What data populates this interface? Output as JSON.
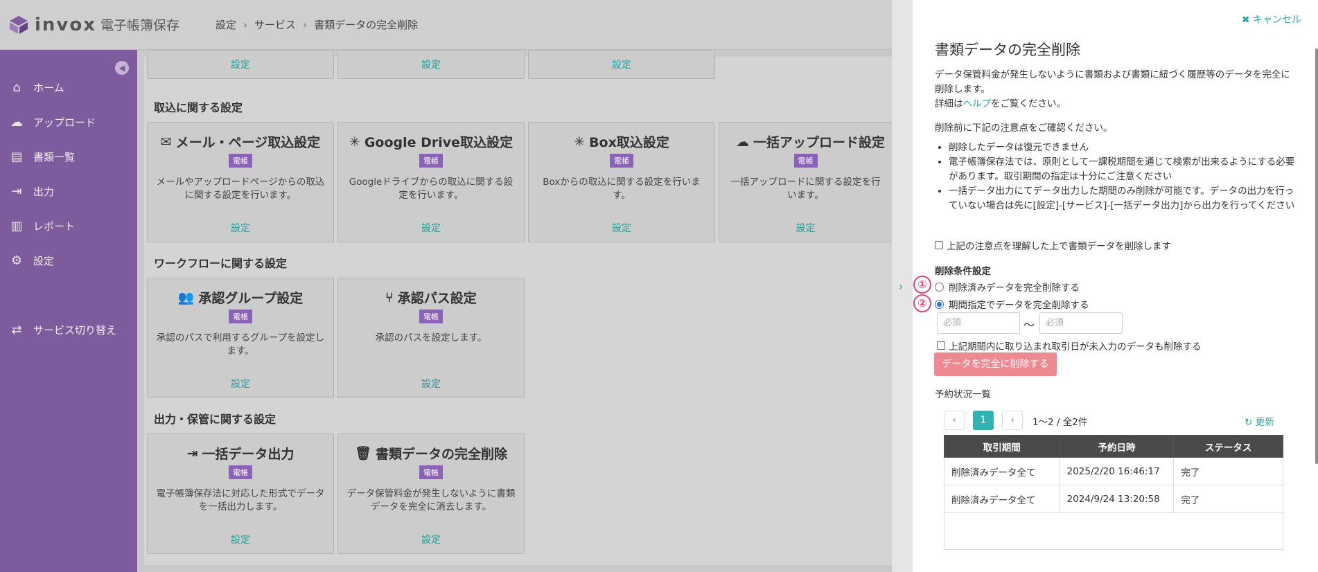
{
  "header": {
    "logo_text": "invox",
    "logo_sub": "電子帳簿保存",
    "breadcrumb": [
      "設定",
      "サービス",
      "書類データの完全削除"
    ]
  },
  "sidebar": {
    "items": [
      {
        "label": "ホーム",
        "icon": "home-icon"
      },
      {
        "label": "アップロード",
        "icon": "cloud-upload-icon"
      },
      {
        "label": "書類一覧",
        "icon": "document-icon"
      },
      {
        "label": "出力",
        "icon": "export-icon"
      },
      {
        "label": "レポート",
        "icon": "chart-icon"
      },
      {
        "label": "設定",
        "icon": "gear-icon"
      },
      {
        "label": "サービス切り替え",
        "icon": "switch-icon"
      }
    ]
  },
  "main": {
    "top_links": [
      "設定",
      "設定",
      "設定"
    ],
    "sections": [
      {
        "title": "取込に関する設定"
      },
      {
        "title": "ワークフローに関する設定"
      },
      {
        "title": "出力・保管に関する設定"
      }
    ],
    "cards": [
      {
        "title": "メール・ページ取込設定",
        "badge": "電帳",
        "desc": "メールやアップロードページからの取込に関する設定を行います。",
        "link": "設定"
      },
      {
        "title": "Google Drive取込設定",
        "badge": "電帳",
        "desc": "Googleドライブからの取込に関する設定を行います。",
        "link": "設定"
      },
      {
        "title": "Box取込設定",
        "badge": "電帳",
        "desc": "Boxからの取込に関する設定を行います。",
        "link": "設定"
      },
      {
        "title": "一括アップロード設定",
        "badge": "電帳",
        "desc": "一括アップロードに関する設定を行います。",
        "link": "設定"
      },
      {
        "title": "承認グループ設定",
        "badge": "電帳",
        "desc": "承認のパスで利用するグループを設定します。",
        "link": "設定"
      },
      {
        "title": "承認パス設定",
        "badge": "電帳",
        "desc": "承認のパスを設定します。",
        "link": "設定"
      },
      {
        "title": "一括データ出力",
        "badge": "電帳",
        "desc": "電子帳簿保存法に対応した形式でデータを一括出力します。",
        "link": "設定"
      },
      {
        "title": "書類データの完全削除",
        "badge": "電帳",
        "desc": "データ保管料金が発生しないように書類データを完全に消去します。",
        "link": "設定"
      }
    ]
  },
  "panel": {
    "cancel_label": "キャンセル",
    "title": "書類データの完全削除",
    "intro_1": "データ保管料金が発生しないように書類および書類に紐づく履歴等のデータを完全に削除します。",
    "intro_2_pre": "詳細は",
    "intro_2_link": "ヘルプ",
    "intro_2_post": "をご覧ください。",
    "notice_lead": "削除前に下記の注意点をご確認ください。",
    "notes": [
      "削除したデータは復元できません",
      "電子帳簿保存法では、原則として一課税期間を通じて検索が出来るようにする必要があります。取引期間の指定は十分にご注意ください",
      "一括データ出力にてデータ出力した期間のみ削除が可能です。データの出力を行っていない場合は先に[設定]-[サービス]-[一括データ出力]から出力を行ってください"
    ],
    "confirm_checkbox": "上記の注意点を理解した上で書類データを削除します",
    "conditions_title": "削除条件設定",
    "radio_1": "削除済みデータを完全削除する",
    "radio_2": "期間指定でデータを完全削除する",
    "marker_1": "①",
    "marker_2": "②",
    "date_from_placeholder": "必須",
    "date_to_placeholder": "必須",
    "tilde": "〜",
    "include_checkbox": "上記期間内に取り込まれ取引日が未入力のデータも削除する",
    "delete_button": "データを完全に削除する",
    "reservation_title": "予約状況一覧",
    "pagination": {
      "current": "1",
      "info": "1〜2 / 全2件"
    },
    "refresh_label": "更新",
    "table": {
      "headers": [
        "取引期間",
        "予約日時",
        "ステータス"
      ],
      "rows": [
        [
          "削除済みデータ全て",
          "2025/2/20 16:46:17",
          "完了"
        ],
        [
          "削除済みデータ全て",
          "2024/9/24 13:20:58",
          "完了"
        ]
      ]
    }
  }
}
